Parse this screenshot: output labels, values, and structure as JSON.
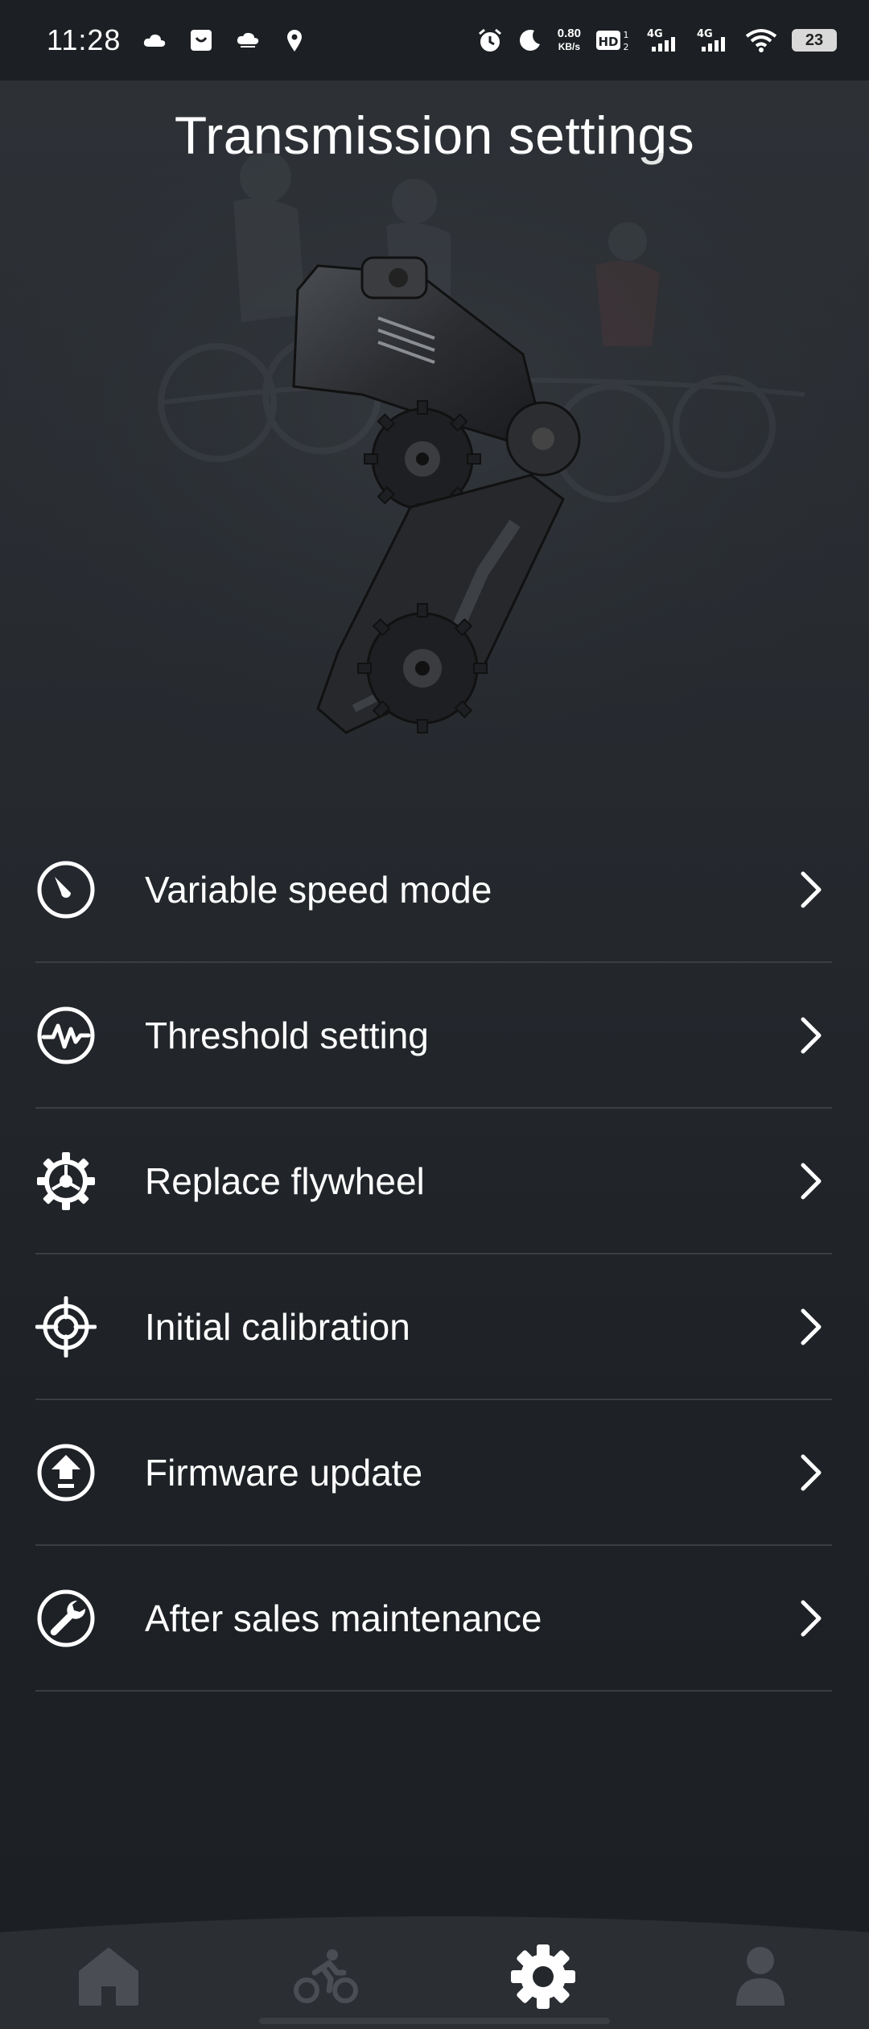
{
  "status_bar": {
    "time": "11:28",
    "net_speed_value": "0.80",
    "net_speed_unit": "KB/s",
    "hd_label": "HD",
    "sim1": "4G",
    "sim2": "4G",
    "battery": "23",
    "left_icons": [
      "cloud-icon",
      "shopping-bag-icon",
      "cloud-icon",
      "location-pin-icon"
    ],
    "right_icons": [
      "alarm-icon",
      "moon-icon",
      "hd-icon",
      "signal-icon",
      "signal-icon",
      "wifi-icon",
      "battery-icon"
    ]
  },
  "header": {
    "title": "Transmission settings"
  },
  "settings": {
    "items": [
      {
        "label": "Variable speed mode",
        "icon": "speedometer-icon"
      },
      {
        "label": "Threshold setting",
        "icon": "waveform-icon"
      },
      {
        "label": "Replace flywheel",
        "icon": "gear-icon"
      },
      {
        "label": "Initial calibration",
        "icon": "crosshair-icon"
      },
      {
        "label": "Firmware update",
        "icon": "upload-icon"
      },
      {
        "label": "After sales maintenance",
        "icon": "wrench-icon"
      }
    ]
  },
  "bottom_nav": {
    "items": [
      {
        "icon": "home-icon",
        "active": false
      },
      {
        "icon": "cyclist-icon",
        "active": false
      },
      {
        "icon": "settings-gear-icon",
        "active": true
      },
      {
        "icon": "profile-icon",
        "active": false
      }
    ]
  },
  "colors": {
    "background_top": "#2e3237",
    "background_bottom": "#1c1f23",
    "text": "#ffffff",
    "divider": "#3a3e43",
    "nav_inactive": "#4a4e54",
    "nav_active": "#ffffff"
  }
}
